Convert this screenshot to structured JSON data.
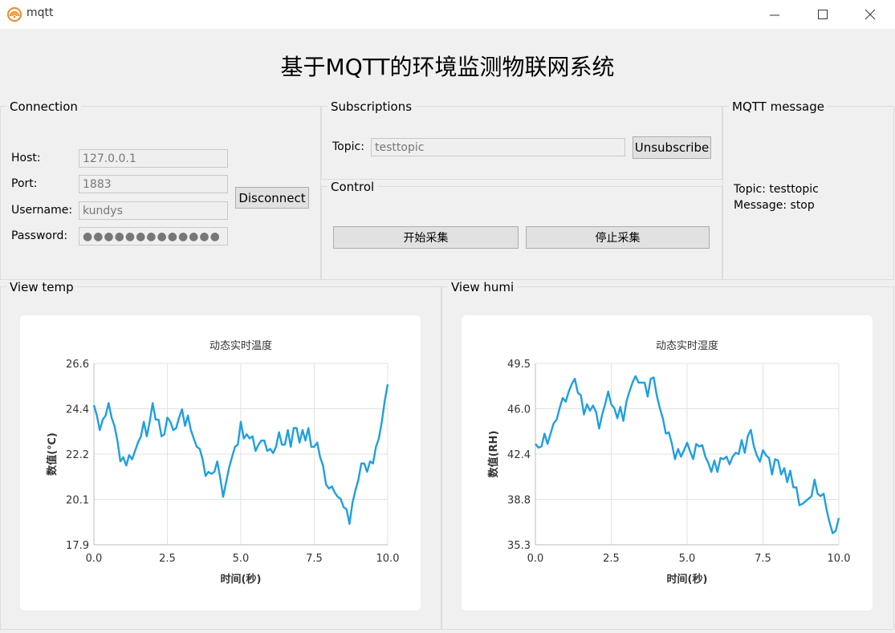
{
  "window": {
    "title": "mqtt"
  },
  "main_title": "基于MQTT的环境监测物联网系统",
  "connection": {
    "label": "Connection",
    "host_label": "Host:",
    "host_value": "127.0.0.1",
    "port_label": "Port:",
    "port_value": "1883",
    "username_label": "Username:",
    "username_value": "kundys",
    "password_label": "Password:",
    "password_value": "●●●●●●●●●●●●●",
    "disconnect_label": "Disconnect"
  },
  "subscriptions": {
    "label": "Subscriptions",
    "topic_label": "Topic:",
    "topic_value": "testtopic",
    "unsubscribe_label": "Unsubscribe"
  },
  "control": {
    "label": "Control",
    "start_label": "开始采集",
    "stop_label": "停止采集"
  },
  "mqtt_message": {
    "label": "MQTT  message",
    "topic_line": "Topic: testtopic",
    "message_line": "Message: stop"
  },
  "view_temp": {
    "label": "View  temp"
  },
  "view_humi": {
    "label": "View  humi"
  },
  "colors": {
    "series": "#209fdf",
    "grid": "#e2e2e2"
  },
  "icons": {
    "app": "mqtt-app-icon",
    "minimize": "minimize-icon",
    "maximize": "maximize-icon",
    "close": "close-icon"
  },
  "chart_data": [
    {
      "type": "line",
      "title": "动态实时温度",
      "xlabel": "时间(秒)",
      "ylabel": "数值(℃)",
      "xlim": [
        0,
        10
      ],
      "ylim": [
        17.9,
        26.6
      ],
      "xticks": [
        "0.0",
        "2.5",
        "5.0",
        "7.5",
        "10.0"
      ],
      "yticks": [
        "26.6",
        "24.4",
        "22.2",
        "20.1",
        "17.9"
      ],
      "grid": true,
      "series": [
        {
          "x": [
            0,
            0.1,
            0.2,
            0.3,
            0.4,
            0.5,
            0.6,
            0.7,
            0.8,
            0.9,
            1.0,
            1.1,
            1.2,
            1.3,
            1.4,
            1.5,
            1.6,
            1.7,
            1.8,
            1.9,
            2.0,
            2.1,
            2.2,
            2.3,
            2.4,
            2.5,
            2.6,
            2.7,
            2.8,
            2.9,
            3.0,
            3.1,
            3.2,
            3.3,
            3.4,
            3.5,
            3.6,
            3.7,
            3.8,
            3.9,
            4.0,
            4.1,
            4.2,
            4.3,
            4.4,
            4.5,
            4.6,
            4.7,
            4.8,
            4.9,
            5.0,
            5.1,
            5.2,
            5.3,
            5.4,
            5.5,
            5.6,
            5.7,
            5.8,
            5.9,
            6.0,
            6.1,
            6.2,
            6.3,
            6.4,
            6.5,
            6.6,
            6.7,
            6.8,
            6.9,
            7.0,
            7.1,
            7.2,
            7.3,
            7.4,
            7.5,
            7.6,
            7.7,
            7.8,
            7.9,
            8.0,
            8.1,
            8.2,
            8.3,
            8.4,
            8.5,
            8.6,
            8.7,
            8.8,
            8.9,
            9.0,
            9.1,
            9.2,
            9.3,
            9.4,
            9.5,
            9.6,
            9.7,
            9.8,
            9.9,
            10.0
          ],
          "y": [
            24.6,
            24.1,
            23.4,
            23.9,
            24.1,
            24.7,
            24.0,
            23.6,
            22.9,
            21.9,
            22.1,
            21.7,
            22.2,
            22.0,
            22.4,
            22.8,
            23.1,
            23.8,
            23.1,
            23.8,
            24.7,
            23.9,
            23.9,
            23.1,
            23.2,
            24.0,
            23.8,
            23.4,
            23.5,
            24.0,
            24.4,
            23.6,
            24.1,
            23.4,
            23.0,
            22.6,
            22.5,
            22.0,
            21.2,
            21.4,
            21.3,
            21.4,
            21.9,
            21.1,
            20.2,
            20.9,
            21.6,
            22.1,
            22.6,
            22.7,
            23.8,
            23.0,
            23.2,
            23.0,
            23.1,
            22.4,
            22.7,
            22.9,
            22.9,
            22.4,
            22.5,
            22.3,
            22.6,
            23.3,
            22.7,
            22.7,
            23.4,
            22.6,
            23.5,
            23.5,
            22.8,
            23.4,
            22.9,
            23.5,
            22.6,
            22.6,
            22.8,
            22.1,
            21.7,
            20.8,
            20.6,
            20.7,
            20.4,
            20.2,
            20.1,
            19.7,
            19.6,
            18.9,
            19.9,
            20.5,
            21.0,
            21.8,
            21.8,
            21.4,
            21.9,
            21.8,
            22.6,
            23.0,
            23.8,
            24.8,
            25.6
          ]
        }
      ]
    },
    {
      "type": "line",
      "title": "动态实时湿度",
      "xlabel": "时间(秒)",
      "ylabel": "数值(RH)",
      "xlim": [
        0,
        10
      ],
      "ylim": [
        35.3,
        49.5
      ],
      "xticks": [
        "0.0",
        "2.5",
        "5.0",
        "7.5",
        "10.0"
      ],
      "yticks": [
        "49.5",
        "46.0",
        "42.4",
        "38.8",
        "35.3"
      ],
      "grid": true,
      "series": [
        {
          "x": [
            0,
            0.1,
            0.2,
            0.3,
            0.4,
            0.5,
            0.6,
            0.7,
            0.8,
            0.9,
            1.0,
            1.1,
            1.2,
            1.3,
            1.4,
            1.5,
            1.6,
            1.7,
            1.8,
            1.9,
            2.0,
            2.1,
            2.2,
            2.3,
            2.4,
            2.5,
            2.6,
            2.7,
            2.8,
            2.9,
            3.0,
            3.1,
            3.2,
            3.3,
            3.4,
            3.5,
            3.6,
            3.7,
            3.8,
            3.9,
            4.0,
            4.1,
            4.2,
            4.3,
            4.4,
            4.5,
            4.6,
            4.7,
            4.8,
            4.9,
            5.0,
            5.1,
            5.2,
            5.3,
            5.4,
            5.5,
            5.6,
            5.7,
            5.8,
            5.9,
            6.0,
            6.1,
            6.2,
            6.3,
            6.4,
            6.5,
            6.6,
            6.7,
            6.8,
            6.9,
            7.0,
            7.1,
            7.2,
            7.3,
            7.4,
            7.5,
            7.6,
            7.7,
            7.8,
            7.9,
            8.0,
            8.1,
            8.2,
            8.3,
            8.4,
            8.5,
            8.6,
            8.7,
            8.8,
            8.9,
            9.0,
            9.1,
            9.2,
            9.3,
            9.4,
            9.5,
            9.6,
            9.7,
            9.8,
            9.9,
            10.0
          ],
          "y": [
            43.2,
            42.9,
            43.0,
            44.0,
            43.2,
            44.0,
            44.8,
            45.1,
            46.0,
            46.8,
            46.5,
            47.3,
            47.9,
            48.3,
            47.2,
            47.0,
            45.5,
            46.3,
            45.8,
            46.2,
            45.7,
            44.4,
            45.5,
            46.3,
            47.3,
            46.3,
            46.0,
            45.2,
            46.1,
            45.0,
            46.5,
            47.3,
            48.0,
            48.5,
            48.0,
            48.0,
            48.0,
            46.9,
            48.3,
            48.4,
            47.0,
            46.0,
            45.2,
            44.0,
            44.1,
            43.2,
            42.0,
            42.8,
            42.2,
            42.7,
            43.3,
            42.6,
            42.0,
            43.2,
            43.0,
            43.1,
            42.2,
            41.7,
            41.0,
            41.9,
            41.0,
            42.1,
            42.0,
            42.2,
            41.6,
            42.2,
            42.5,
            42.4,
            43.5,
            42.5,
            43.8,
            44.3,
            43.0,
            42.3,
            41.8,
            42.7,
            42.3,
            42.1,
            40.8,
            42.0,
            41.9,
            40.8,
            41.3,
            40.2,
            41.1,
            39.8,
            39.8,
            38.4,
            38.5,
            38.7,
            38.9,
            39.1,
            40.4,
            39.3,
            39.1,
            39.3,
            38.0,
            37.0,
            36.2,
            36.4,
            37.4
          ]
        }
      ]
    }
  ]
}
